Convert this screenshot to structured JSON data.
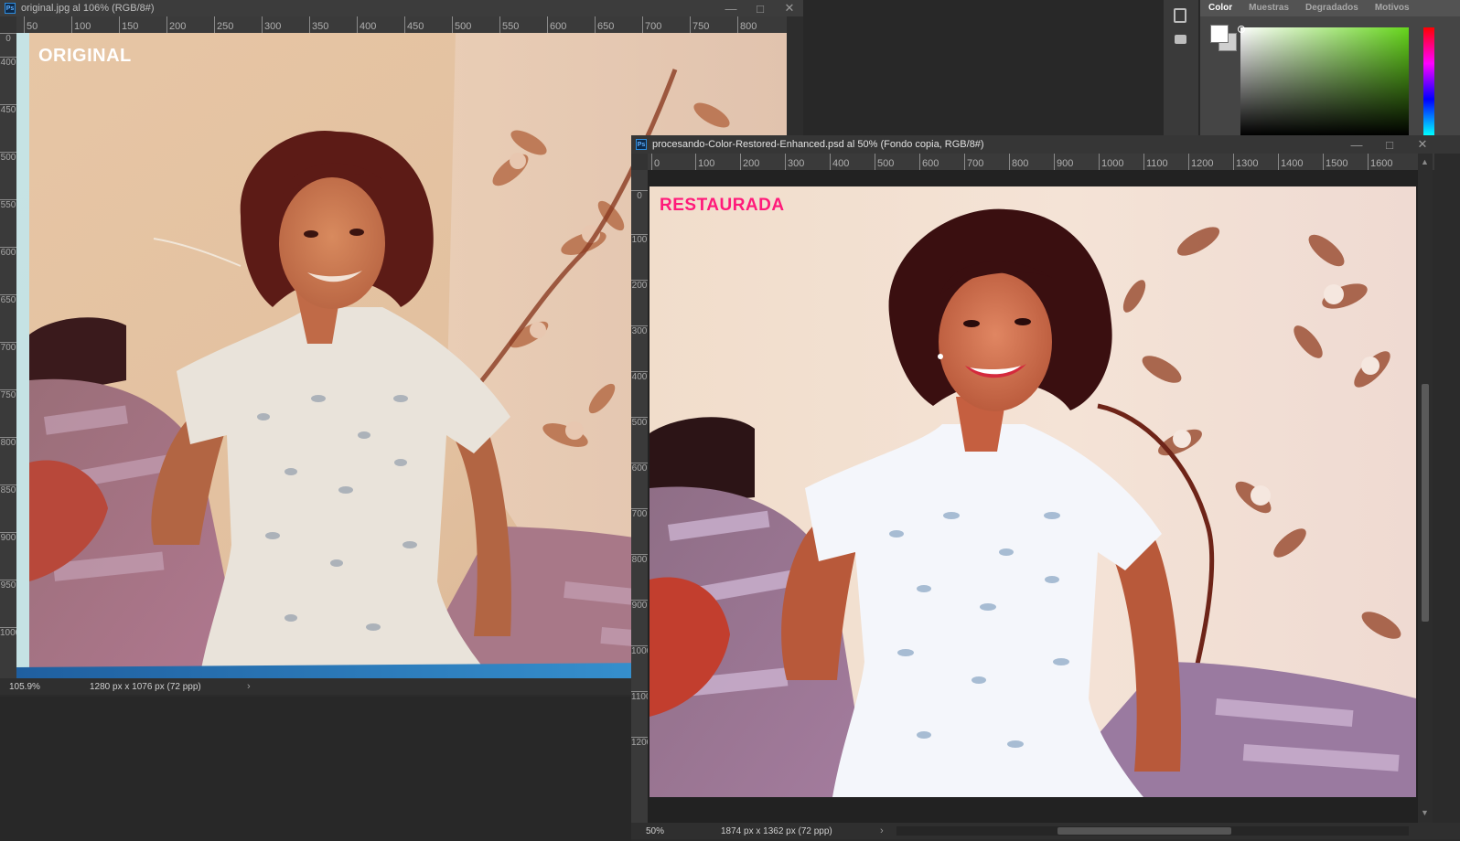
{
  "window_original": {
    "title": "original.jpg al 106% (RGB/8#)",
    "label": "ORIGINAL",
    "ruler_labels": [
      "50",
      "100",
      "150",
      "200",
      "250",
      "300",
      "350",
      "400",
      "450",
      "500",
      "550",
      "600",
      "650",
      "700",
      "750",
      "800"
    ],
    "vruler_labels": [
      "0",
      "400",
      "450",
      "500",
      "550",
      "600",
      "650",
      "700",
      "750",
      "800",
      "850",
      "900",
      "950",
      "1000"
    ],
    "zoom": "105.9%",
    "doc_info": "1280 px x 1076 px (72 ppp)"
  },
  "window_restored": {
    "title": "procesando-Color-Restored-Enhanced.psd al 50% (Fondo copia, RGB/8#)",
    "label": "RESTAURADA",
    "ruler_labels": [
      "0",
      "100",
      "200",
      "300",
      "400",
      "500",
      "600",
      "700",
      "800",
      "900",
      "1000",
      "1100",
      "1200",
      "1300",
      "1400",
      "1500",
      "1600"
    ],
    "vruler_labels": [
      "0",
      "100",
      "200",
      "300",
      "400",
      "500",
      "600",
      "700",
      "800",
      "900",
      "1000",
      "1100",
      "1200"
    ],
    "zoom": "50%",
    "doc_info": "1874 px x 1362 px (72 ppp)"
  },
  "color_panel": {
    "tabs": [
      "Color",
      "Muestras",
      "Degradados",
      "Motivos"
    ],
    "active_tab": "Color"
  },
  "colors": {
    "label_original": "#ffffff",
    "label_restored": "#ff1a7a",
    "ps_accent": "#2d8de0"
  }
}
